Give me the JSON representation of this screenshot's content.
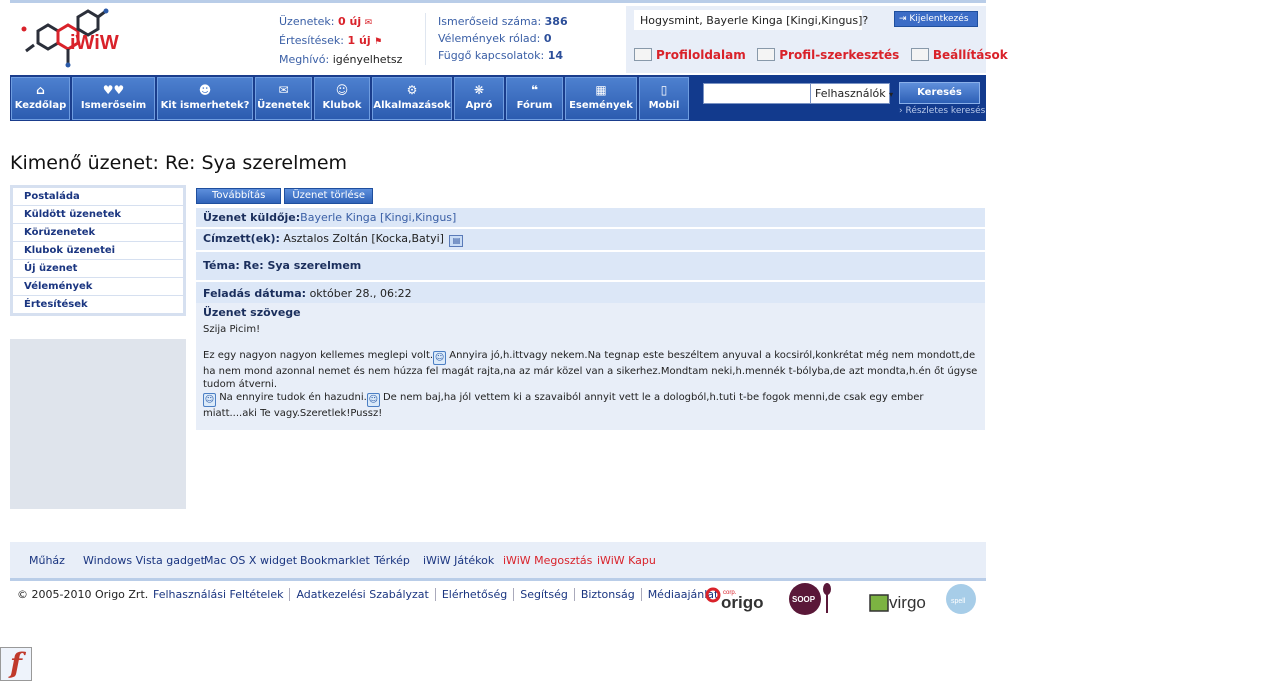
{
  "header": {
    "logo_text": "iWiW",
    "stats_left": [
      {
        "label": "Üzenetek:",
        "value": "0 új"
      },
      {
        "label": "Értesítések:",
        "value": "1 új"
      },
      {
        "label": "Meghívó:",
        "value": "igényelhetsz"
      }
    ],
    "stats_right": [
      {
        "label": "Ismerőseid száma:",
        "value": "386"
      },
      {
        "label": "Vélemények rólad:",
        "value": "0"
      },
      {
        "label": "Függő kapcsolatok:",
        "value": "14"
      }
    ],
    "greeting": "Hogysmint, Bayerle Kinga [Kingi,Kingus]?",
    "logout_label": "Kijelentkezés",
    "profile_links": [
      "Profiloldalam",
      "Profil-szerkesztés",
      "Beállítások"
    ]
  },
  "nav": {
    "items": [
      {
        "label": "Kezdőlap",
        "icon": "home-icon",
        "glyph": "⌂"
      },
      {
        "label": "Ismerőseim",
        "icon": "hearts-icon",
        "glyph": "♥♥"
      },
      {
        "label": "Kit ismerhetek?",
        "icon": "search-person-icon",
        "glyph": "☻"
      },
      {
        "label": "Üzenetek",
        "icon": "envelope-icon",
        "glyph": "✉"
      },
      {
        "label": "Klubok",
        "icon": "group-icon",
        "glyph": "☺"
      },
      {
        "label": "Alkalmazások",
        "icon": "gears-icon",
        "glyph": "⚙"
      },
      {
        "label": "Apró",
        "icon": "tag-icon",
        "glyph": "❋"
      },
      {
        "label": "Fórum",
        "icon": "speech-bubble-icon",
        "glyph": "❝"
      },
      {
        "label": "Események",
        "icon": "calendar-icon",
        "glyph": "▦"
      },
      {
        "label": "Mobil",
        "icon": "mobile-icon",
        "glyph": "▯"
      }
    ]
  },
  "search": {
    "input_value": "",
    "select_value": "Felhasználók",
    "button_label": "Keresés",
    "advanced_label": "Részletes keresés"
  },
  "page": {
    "title": "Kimenő üzenet: Re: Sya szerelmem"
  },
  "sidebar": {
    "items": [
      "Postaláda",
      "Küldött üzenetek",
      "Körüzenetek",
      "Klubok üzenetei",
      "Új üzenet",
      "Vélemények",
      "Értesítések"
    ]
  },
  "actions": {
    "forward": "Továbbítás",
    "delete": "Üzenet törlése"
  },
  "message": {
    "sender_label": "Üzenet küldője:",
    "sender_value": "Bayerle Kinga [Kingi,Kingus]",
    "recipient_label": "Címzett(ek):",
    "recipient_value": "Asztalos Zoltán [Kocka,Batyi]",
    "subject_label": "Téma:",
    "subject_value": "Re: Sya szerelmem",
    "date_label": "Feladás dátuma:",
    "date_value": "október 28., 06:22",
    "body_label": "Üzenet szövege",
    "greeting": "Szija Picim!",
    "p1": "Ez egy nagyon nagyon kellemes meglepi volt.",
    "p2": "Annyira jó,h.ittvagy nekem.Na tegnap este beszéltem anyuval a kocsiról,konkrétat még nem mondott,de ha nem mond azonnal nemet és nem húzza fel magát rajta,na az már közel van a sikerhez.Mondtam neki,h.mennék t-bólyba,de azt mondta,h.én őt úgyse tudom átverni.",
    "p3": "Na ennyire tudok én hazudni.",
    "p4": "De nem baj,ha jól vettem ki a szavaiból annyit vett le a dologból,h.tuti t-be fogok menni,de csak egy ember miatt....aki Te vagy.Szeretlek!Pussz!"
  },
  "footer": {
    "links1": [
      {
        "label": "Műház",
        "color": "#1a3580"
      },
      {
        "label": "Windows Vista gadget",
        "color": "#1a3580"
      },
      {
        "label": "Mac OS X widget",
        "color": "#1a3580"
      },
      {
        "label": "Bookmarklet",
        "color": "#1a3580"
      },
      {
        "label": "Térkép",
        "color": "#1a3580"
      },
      {
        "label": "iWiW Játékok",
        "color": "#1a3580"
      },
      {
        "label": "iWiW Megosztás",
        "color": "#d9222a"
      },
      {
        "label": "iWiW Kapu",
        "color": "#d9222a"
      }
    ],
    "copyright": "© 2005-2010 Origo Zrt.",
    "links2": [
      "Felhasználási Feltételek",
      "Adatkezelési Szabályzat",
      "Elérhetőség",
      "Segítség",
      "Biztonság",
      "Médiaajánlat"
    ],
    "partners": [
      "origo",
      "SOOP",
      "virgo",
      "spell"
    ],
    "origo_tag": "corp."
  },
  "flash_glyph": "f"
}
